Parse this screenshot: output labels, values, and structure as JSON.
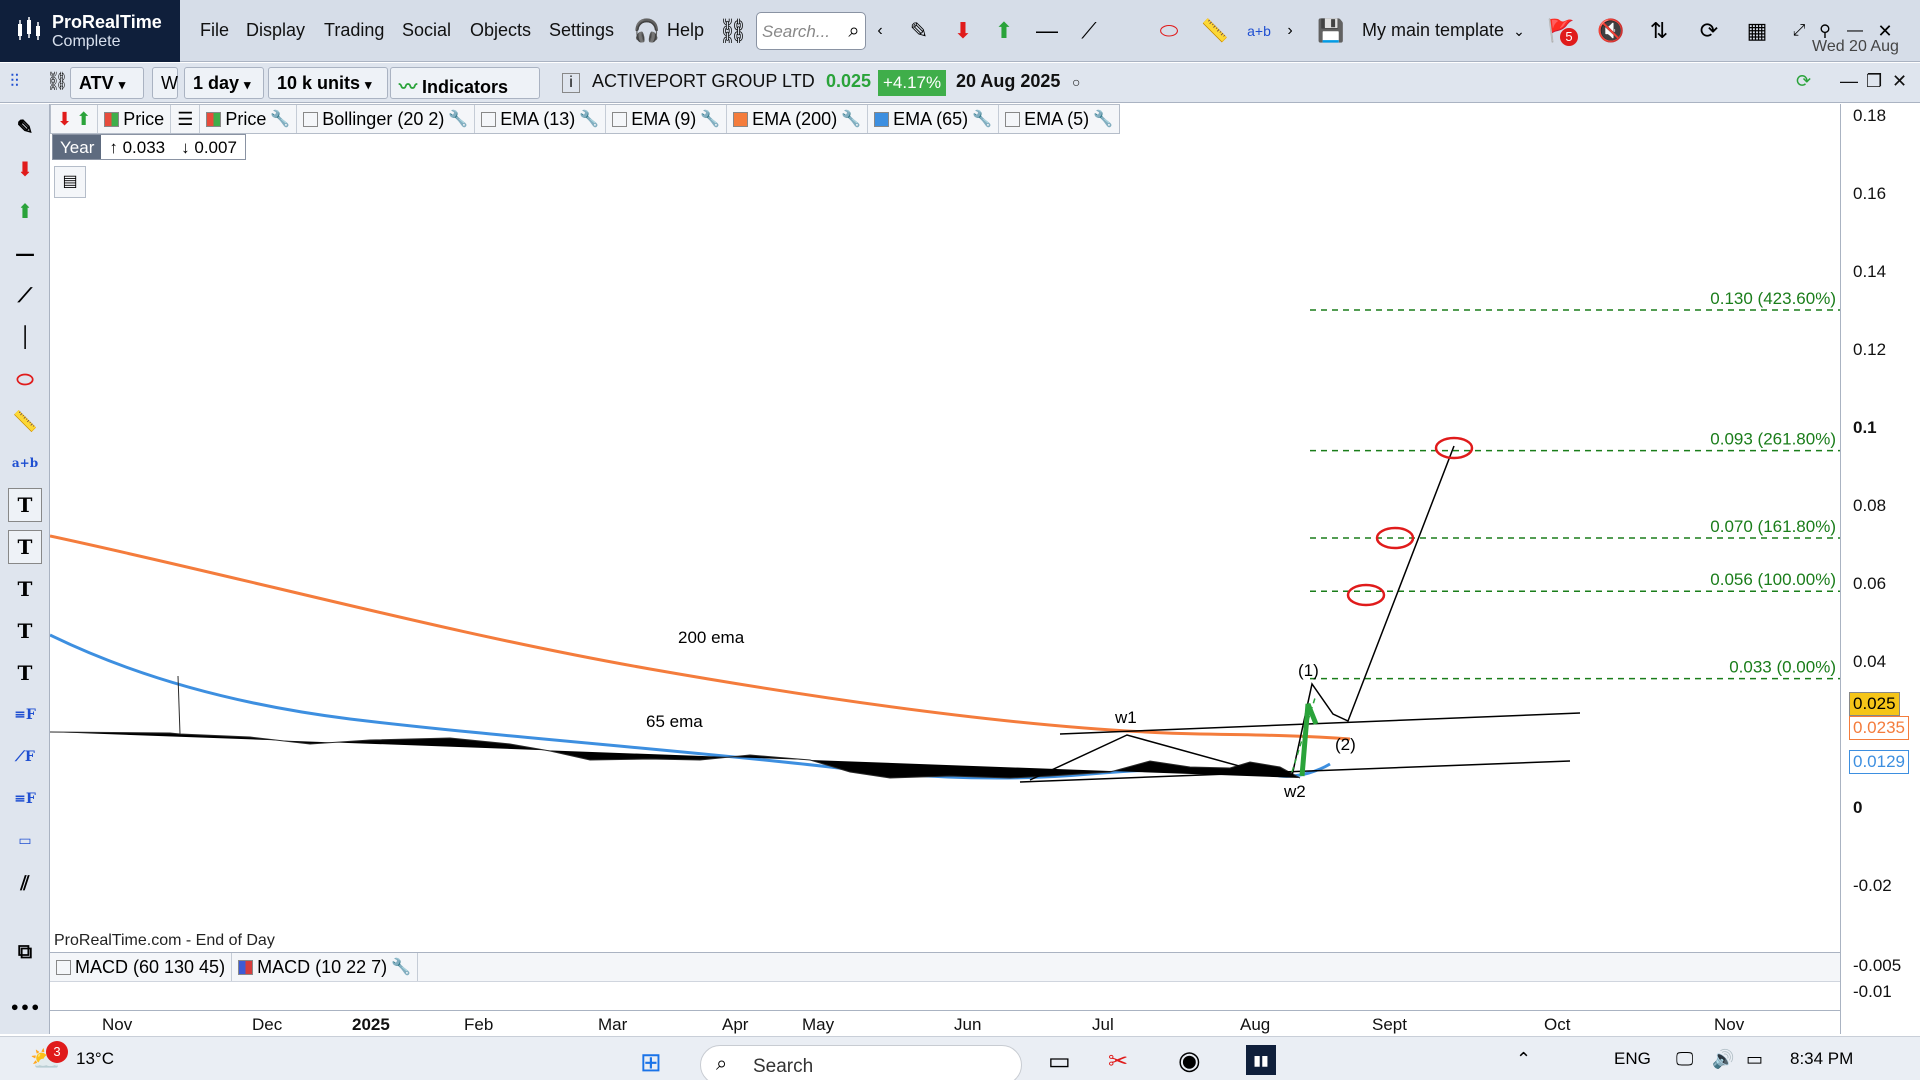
{
  "app": {
    "name": "ProRealTime",
    "edition": "Complete"
  },
  "menu": [
    "File",
    "Display",
    "Trading",
    "Social",
    "Objects",
    "Settings",
    "Help"
  ],
  "search": {
    "placeholder": "Search..."
  },
  "template": {
    "label": "My main template"
  },
  "header_date": "Wed 20 Aug",
  "notification_count": "5",
  "toolbar2": {
    "symbol": "ATV",
    "period_letter": "W",
    "interval": "1 day",
    "units": "10 k units",
    "indicators_label": "Indicators",
    "instrument": "ACTIVEPORT GROUP LTD",
    "last_price": "0.025",
    "change_pct": "+4.17%",
    "date": "20 Aug 2025"
  },
  "legend": [
    {
      "label": "Price",
      "color": "#3fae4a"
    },
    {
      "label": "Price",
      "color": "#3fae4a"
    },
    {
      "label": "Bollinger (20 2)",
      "color": ""
    },
    {
      "label": "EMA (13)",
      "color": ""
    },
    {
      "label": "EMA (9)",
      "color": ""
    },
    {
      "label": "EMA (200)",
      "color": "#f47c3c"
    },
    {
      "label": "EMA (65)",
      "color": "#3d8fe0"
    },
    {
      "label": "EMA (5)",
      "color": ""
    }
  ],
  "year_box": {
    "label": "Year",
    "high": "0.033",
    "low": "0.007"
  },
  "chart_data": {
    "type": "line",
    "price_ticks": [
      "0.18",
      "0.16",
      "0.14",
      "0.12",
      "0.1",
      "0.08",
      "0.06",
      "0.04",
      "0",
      "-0.02"
    ],
    "macd_ticks": [
      "-0.005",
      "-0.01"
    ],
    "time_labels": [
      "Nov",
      "Dec",
      "2025",
      "Feb",
      "Mar",
      "Apr",
      "May",
      "Jun",
      "Jul",
      "Aug",
      "Sept",
      "Oct",
      "Nov"
    ],
    "price_tags": [
      {
        "value": "0.025",
        "color": "#f5c518",
        "text_color": "#000"
      },
      {
        "value": "0.0235",
        "color": "#ffffff",
        "text_color": "#f47c3c"
      },
      {
        "value": "0.0129",
        "color": "#ffffff",
        "text_color": "#3d8fe0"
      }
    ],
    "fib_levels": [
      {
        "price": 0.13,
        "label": "0.130 (423.60%)"
      },
      {
        "price": 0.093,
        "label": "0.093 (261.80%)"
      },
      {
        "price": 0.07,
        "label": "0.070 (161.80%)"
      },
      {
        "price": 0.056,
        "label": "0.056 (100.00%)"
      },
      {
        "price": 0.033,
        "label": "0.033 (0.00%)"
      }
    ],
    "annotations": [
      "200 ema",
      "65 ema",
      "w1",
      "w2",
      "(1)",
      "(2)"
    ],
    "source_label": "ProRealTime.com - End of Day"
  },
  "macd_legend": [
    {
      "label": "MACD (60 130 45)",
      "color": ""
    },
    {
      "label": "MACD (10 22 7)",
      "color": "#3d5bd6"
    }
  ],
  "taskbar": {
    "weather": "13°C",
    "weather_badge": "3",
    "search": "Search",
    "lang": "ENG",
    "time": "8:34 PM"
  }
}
